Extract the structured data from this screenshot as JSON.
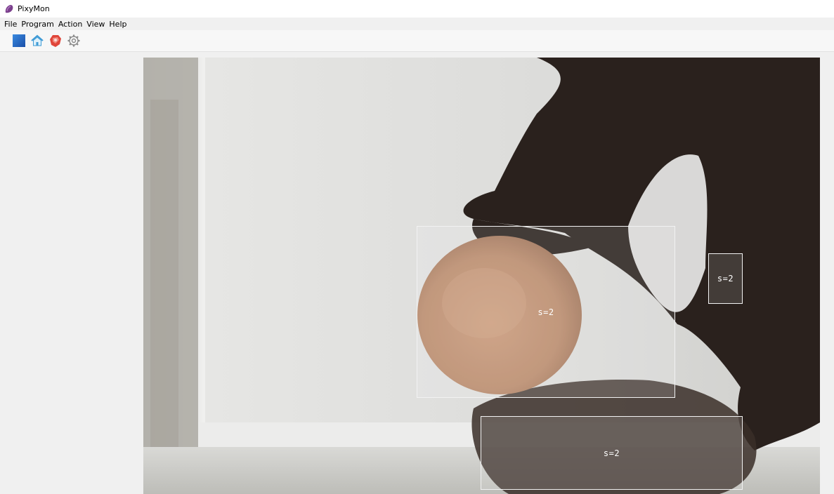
{
  "window": {
    "title": "PixyMon"
  },
  "menu": {
    "items": [
      "File",
      "Program",
      "Action",
      "View",
      "Help"
    ]
  },
  "toolbar": {
    "buttons": [
      "stop-icon",
      "home-icon",
      "pixy-icon",
      "gear-icon"
    ]
  },
  "detections": [
    {
      "label": "s=2"
    },
    {
      "label": "s=2"
    },
    {
      "label": "s=2"
    }
  ]
}
